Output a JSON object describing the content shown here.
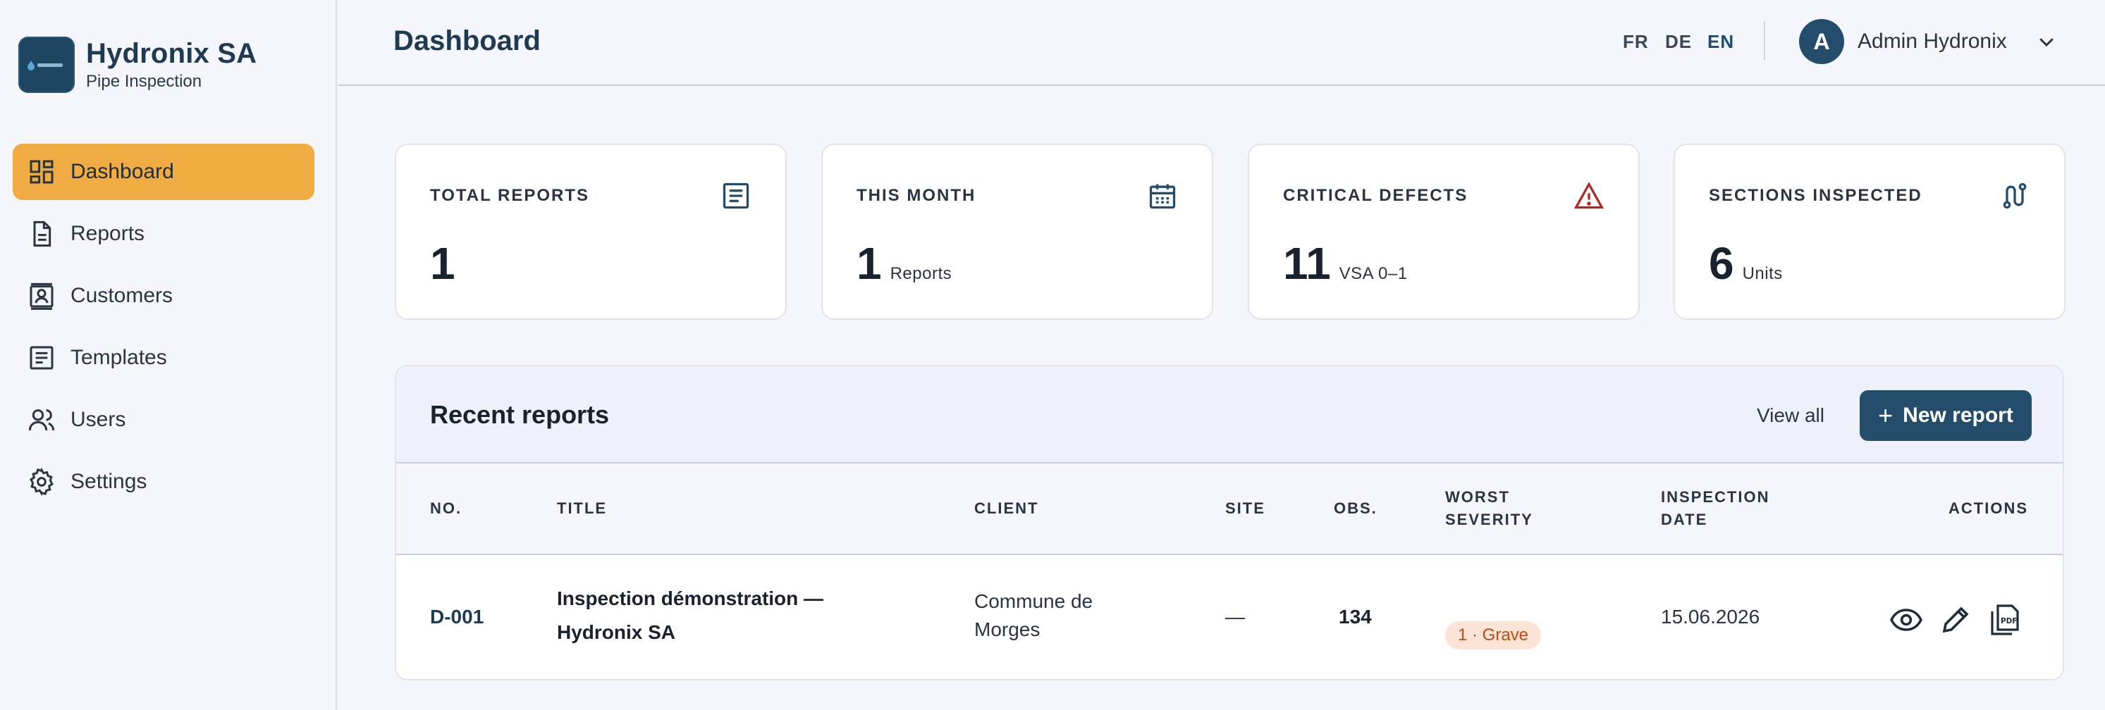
{
  "brand": {
    "name": "Hydronix SA",
    "subtitle": "Pipe Inspection"
  },
  "sidebar": {
    "items": [
      {
        "label": "Dashboard",
        "icon": "dashboard-icon",
        "active": true
      },
      {
        "label": "Reports",
        "icon": "document-icon"
      },
      {
        "label": "Customers",
        "icon": "customer-card-icon"
      },
      {
        "label": "Templates",
        "icon": "template-icon"
      },
      {
        "label": "Users",
        "icon": "users-icon"
      },
      {
        "label": "Settings",
        "icon": "gear-icon"
      }
    ]
  },
  "header": {
    "title": "Dashboard",
    "languages": [
      "FR",
      "DE",
      "EN"
    ],
    "active_language": "EN",
    "user": {
      "initial": "A",
      "name": "Admin Hydronix"
    }
  },
  "stats": [
    {
      "label": "TOTAL REPORTS",
      "value": "1",
      "unit": "",
      "icon": "report-list-icon"
    },
    {
      "label": "THIS MONTH",
      "value": "1",
      "unit": "Reports",
      "icon": "calendar-icon"
    },
    {
      "label": "CRITICAL DEFECTS",
      "value": "11",
      "unit": "VSA 0–1",
      "icon": "warning-icon"
    },
    {
      "label": "SECTIONS INSPECTED",
      "value": "6",
      "unit": "Units",
      "icon": "pipe-route-icon"
    }
  ],
  "recent": {
    "title": "Recent reports",
    "view_all": "View all",
    "new_report": "New report",
    "columns": {
      "no": "NO.",
      "title": "TITLE",
      "client": "CLIENT",
      "site": "SITE",
      "obs": "OBS.",
      "worst_line1": "WORST",
      "worst_line2": "SEVERITY",
      "date_line1": "INSPECTION",
      "date_line2": "DATE",
      "actions": "ACTIONS"
    },
    "rows": [
      {
        "no": "D-001",
        "title_line1": "Inspection démonstration —",
        "title_line2": "Hydronix SA",
        "client_line1": "Commune de",
        "client_line2": "Morges",
        "site": "—",
        "obs": "134",
        "severity": "1 · Grave",
        "date": "15.06.2026"
      }
    ]
  },
  "colors": {
    "accent": "#f0ac42",
    "primary": "#244c6b",
    "danger": "#b3261e",
    "badge_bg": "#fbe4d5",
    "badge_text": "#c24a14"
  }
}
